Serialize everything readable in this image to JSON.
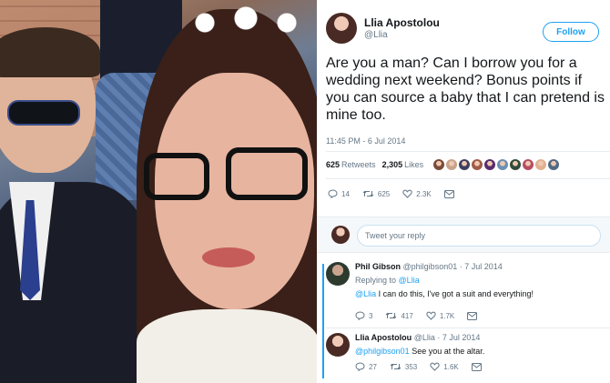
{
  "tweet": {
    "display_name": "Llia Apostolou",
    "handle": "@Llia",
    "follow_label": "Follow",
    "text": "Are you a man? Can I borrow you for a wedding next weekend? Bonus points if you can source a baby that I can pretend is mine too.",
    "timestamp": "11:45 PM - 6 Jul 2014",
    "retweets_count": "625",
    "retweets_label": "Retweets",
    "likes_count": "2,305",
    "likes_label": "Likes",
    "likers_colors": [
      "#7a4b3a",
      "#c7a38b",
      "#3e3e5e",
      "#a05c48",
      "#5a2c6e",
      "#6b8fb5",
      "#2f4a3a",
      "#b84d62",
      "#e0b090",
      "#4f6a84"
    ],
    "actions": {
      "replies": "14",
      "retweets": "625",
      "likes": "2.3K"
    }
  },
  "reply_box": {
    "placeholder": "Tweet your reply"
  },
  "replies": [
    {
      "name": "Phil Gibson",
      "handle": "@philgibson01",
      "date": "7 Jul 2014",
      "replying_to_prefix": "Replying to",
      "replying_to": "@Llia",
      "mention": "@Llia",
      "text": "I can do this, I've got a suit and everything!",
      "actions": {
        "replies": "3",
        "retweets": "417",
        "likes": "1.7K"
      }
    },
    {
      "name": "Llia Apostolou",
      "handle": "@Llia",
      "date": "7 Jul 2014",
      "mention": "@philgibson01",
      "text": "See you at the altar.",
      "actions": {
        "replies": "27",
        "retweets": "353",
        "likes": "1.6K"
      }
    }
  ],
  "colors": {
    "accent": "#1da1f2",
    "muted": "#657786",
    "text": "#14171a"
  }
}
